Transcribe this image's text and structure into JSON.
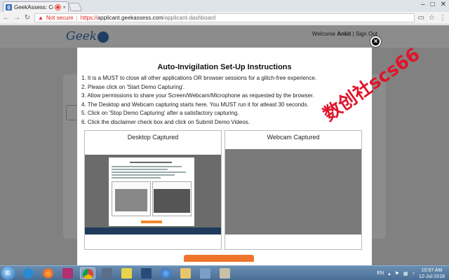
{
  "browser": {
    "tab_title": "GeekAssess: Compr",
    "tab_close": "×",
    "security_label": "Not secure",
    "url_scheme": "https://",
    "url_host": "applicant.geekassess.com",
    "url_path": "/applicant-dashboard",
    "window_controls": [
      "–",
      "□",
      "✕"
    ]
  },
  "site": {
    "logo_text": "Geek",
    "welcome_prefix": "Welcome",
    "user_name": "Ankit",
    "separator": "|",
    "sign_out": "Sign Out"
  },
  "modal": {
    "title": "Auto-Invigilation Set-Up Instructions",
    "close_label": "×",
    "instructions": [
      "1. It is a MUST to close all other applications OR browser sessions for a glitch-free experience.",
      "2. Please click on 'Start Demo Capturing'.",
      "3. Allow permissions to share your Screen/Webcam/Microphone as requested by the browser.",
      "4. The Desktop and Webcam capturing starts here. You MUST run it for atleast 30 seconds.",
      "5. Click on 'Stop Demo Capturing' after a satisfactory capturing.",
      "6. Click the disclaimer check box and click on Submit Demo Videos."
    ],
    "desktop_panel_title": "Desktop Captured",
    "webcam_panel_title": "Webcam Captured"
  },
  "watermark": "数创社scs66",
  "taskbar": {
    "language": "EN",
    "time": "10:57 AM",
    "date": "12-Jul-2018"
  },
  "colors": {
    "accent": "#3a6fb5",
    "orange": "#f0752c",
    "watermark": "#e0142a"
  },
  "icons": [
    "start-orb-icon",
    "ie-icon",
    "firefox-icon",
    "winrar-icon",
    "chrome-icon",
    "network-icon",
    "sticky-icon",
    "player-icon",
    "firefox2-icon",
    "explorer-icon",
    "photos-icon",
    "paint-icon"
  ]
}
